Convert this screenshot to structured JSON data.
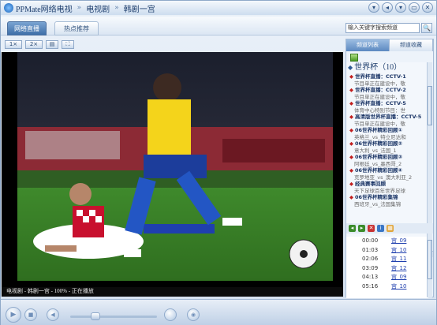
{
  "titlebar": {
    "app_name": "PPMate网络电视",
    "section": "电视剧",
    "program": "韩剧一宫",
    "sep": "»",
    "buttons": [
      "▾",
      "◂",
      "▾",
      "▭",
      "✕"
    ]
  },
  "toolbar": {
    "tab_live": "网络直播",
    "tab_hot": "热点推荐",
    "search_placeholder": "输入关键字搜索频道",
    "search_button": "🔍"
  },
  "view_buttons": [
    "1×",
    "2×",
    "▤",
    "⛶"
  ],
  "status_text": "电视剧 - 韩剧一宫 - 100% - 正在播放",
  "right_panel": {
    "tabs": [
      "频道列表",
      "频道收藏"
    ],
    "group_title": "世界杯（10）",
    "channels": [
      {
        "name": "世界杯直播：CCTV-1",
        "desc": "节目单正在建设中，敬"
      },
      {
        "name": "世界杯直播：CCTV-2",
        "desc": "节目单正在建设中，敬"
      },
      {
        "name": "世界杯直播：CCTV-5",
        "desc": "体育中心特别节目：世"
      },
      {
        "name": "高清版世界杯直播：CCTV-5",
        "desc": "节目单正在建设中，敬"
      },
      {
        "name": "06世界杯精彩回顾①",
        "desc": "英格兰_vs_特立尼达和"
      },
      {
        "name": "06世界杯精彩回顾②",
        "desc": "意大利_vs_法国_1"
      },
      {
        "name": "06世界杯精彩回顾③",
        "desc": "阿根廷_vs_墨西哥_2"
      },
      {
        "name": "06世界杯精彩回顾④",
        "desc": "克罗地亚_vs_澳大利亚_2"
      },
      {
        "name": "经典赛事回顾",
        "desc": "天下足球百年世界足球"
      },
      {
        "name": "06世界杯精彩集锦",
        "desc": "西班牙_vs_法国集锦"
      }
    ],
    "epg": [
      {
        "time": "00:00",
        "program": "宫_09"
      },
      {
        "time": "01:03",
        "program": "宫_10"
      },
      {
        "time": "02:06",
        "program": "宫_11"
      },
      {
        "time": "03:09",
        "program": "宫_12"
      },
      {
        "time": "04:13",
        "program": "宫_09"
      },
      {
        "time": "05:16",
        "program": "宫_10"
      }
    ]
  },
  "colors": {
    "accent": "#3f6fa8",
    "link": "#1f3fae",
    "video_bg": "#000000"
  }
}
